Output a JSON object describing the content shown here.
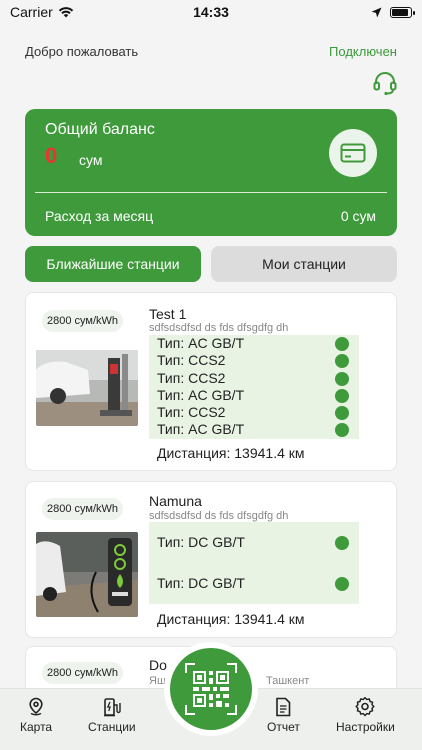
{
  "status": {
    "carrier": "Carrier",
    "time": "14:33",
    "battery_level": 0.9
  },
  "header": {
    "welcome": "Добро пожаловать",
    "connection_status": "Подключен"
  },
  "balance": {
    "title": "Общий баланс",
    "value": "0",
    "currency": "сум",
    "monthly_label": "Расход за месяц",
    "monthly_value": "0 сум"
  },
  "tabs": {
    "nearby": "Ближайшие станции",
    "mine": "Мои станции"
  },
  "stations": [
    {
      "price": "2800 сум/kWh",
      "name": "Test 1",
      "address": "sdfsdsdfsd ds fds dfsgdfg dh",
      "connectors": [
        "Тип: AC GB/T",
        "Тип: CCS2",
        "Тип: CCS2",
        "Тип: AC GB/T",
        "Тип: CCS2",
        "Тип: AC GB/T"
      ],
      "distance": "Дистанция: 13941.4 км"
    },
    {
      "price": "2800 сум/kWh",
      "name": "Namuna",
      "address": "sdfsdsdfsd ds fds dfsgdfg dh",
      "connectors": [
        "Тип: DC GB/T",
        "Тип: DC GB/T"
      ],
      "distance": "Дистанция: 13941.4 км"
    },
    {
      "price": "2800 сум/kWh",
      "name": "Do",
      "address_start": "Яш",
      "address_end": "Ташкент"
    }
  ],
  "nav": {
    "map": "Карта",
    "stations": "Станции",
    "report": "Отчет",
    "settings": "Настройки"
  },
  "colors": {
    "accent": "#3e9a3a",
    "balance_value": "#e33333",
    "background": "#f3f4f3"
  }
}
